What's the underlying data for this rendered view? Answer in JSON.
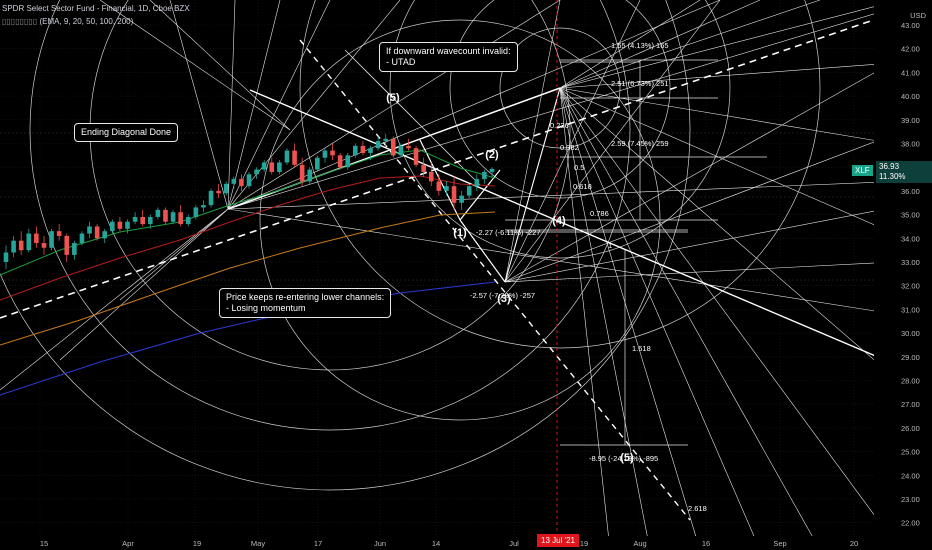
{
  "header": {
    "title": "SPDR Select Sector Fund - Financial, 1D, Cboe BZX",
    "indicator": "EMA, 9, 20, 50, 100, 200",
    "indicator_prefix": "▯▯▯▯▯▯▯▯"
  },
  "price_axis": {
    "currency": "USD",
    "ticks": [
      "43.00",
      "42.00",
      "41.00",
      "40.00",
      "39.00",
      "38.00",
      "37.00",
      "36.00",
      "35.00",
      "34.00",
      "33.00",
      "32.00",
      "31.00",
      "30.00",
      "29.00",
      "28.00",
      "27.00",
      "26.00",
      "25.00",
      "24.00",
      "23.00",
      "22.00"
    ],
    "symbol_badge": "XLF",
    "last_price": "36.93",
    "last_change": "11.30%"
  },
  "time_axis": {
    "labels": [
      "15",
      "Apr",
      "19",
      "May",
      "17",
      "Jun",
      "14",
      "Jul",
      "19",
      "Aug",
      "16",
      "Sep",
      "20"
    ],
    "cursor_label": "13 Jul '21"
  },
  "callouts": {
    "ending_diagonal": "Ending Diagonal Done",
    "wavecount_invalid": "If downward wavecount invalid:\n- UTAD",
    "reentering": "Price keeps re-entering lower channels:\n- Losing momentum"
  },
  "wave_labels": [
    "(5)",
    "(2)",
    "(1)",
    "(4)",
    "(3)",
    "(5)"
  ],
  "fib_labels": [
    "1.65 (4.13%) 165",
    "2.51 (6.73%) 251",
    "2.59 (7.45%) 259",
    "-2.27 (-6.11%) -227",
    "-2.57 (-7.28%) -257",
    "-8.95 (-24.19%) -895",
    "0.236",
    "0.382",
    "0.5",
    "0.618",
    "0.786",
    "1",
    "1.618",
    "2.618"
  ],
  "colors": {
    "background": "#000000",
    "up_candle": "#26a69a",
    "down_candle": "#ef5350",
    "ema_green": "#1b9e3e",
    "ema_red": "#b71c1c",
    "ema_orange": "#c77a1a",
    "ema_blue": "#2b3bd6",
    "fib_lines": "#e6e6e6",
    "cursor": "#e0161c"
  },
  "chart_data": {
    "type": "candlestick",
    "symbol": "XLF",
    "timeframe": "1D",
    "ylim": [
      21.8,
      43.4
    ],
    "x_tick_labels": [
      "15",
      "Apr",
      "19",
      "May",
      "17",
      "Jun",
      "14",
      "Jul",
      "19",
      "Aug",
      "16",
      "Sep",
      "20"
    ],
    "candles": [
      [
        33.0,
        33.7,
        32.7,
        33.4
      ],
      [
        33.4,
        34.1,
        33.2,
        33.9
      ],
      [
        33.9,
        34.3,
        33.3,
        33.5
      ],
      [
        33.5,
        34.4,
        33.4,
        34.2
      ],
      [
        34.2,
        34.5,
        33.6,
        33.8
      ],
      [
        33.8,
        34.1,
        33.3,
        33.6
      ],
      [
        33.6,
        34.4,
        33.5,
        34.3
      ],
      [
        34.3,
        34.6,
        33.9,
        34.1
      ],
      [
        34.1,
        34.2,
        33.0,
        33.3
      ],
      [
        33.3,
        33.9,
        33.1,
        33.8
      ],
      [
        33.8,
        34.3,
        33.7,
        34.2
      ],
      [
        34.2,
        34.7,
        34.0,
        34.5
      ],
      [
        34.5,
        34.6,
        33.9,
        34.0
      ],
      [
        34.0,
        34.4,
        33.8,
        34.3
      ],
      [
        34.3,
        34.8,
        34.2,
        34.7
      ],
      [
        34.7,
        34.9,
        34.3,
        34.4
      ],
      [
        34.4,
        34.8,
        34.2,
        34.7
      ],
      [
        34.7,
        35.1,
        34.6,
        34.9
      ],
      [
        34.9,
        35.2,
        34.5,
        34.6
      ],
      [
        34.6,
        35.0,
        34.4,
        34.9
      ],
      [
        34.9,
        35.3,
        34.8,
        35.2
      ],
      [
        35.2,
        35.3,
        34.6,
        34.7
      ],
      [
        34.7,
        35.2,
        34.6,
        35.1
      ],
      [
        35.1,
        35.4,
        34.5,
        34.6
      ],
      [
        34.6,
        35.0,
        34.5,
        34.9
      ],
      [
        34.9,
        35.4,
        34.8,
        35.3
      ],
      [
        35.3,
        35.6,
        35.1,
        35.4
      ],
      [
        35.4,
        36.1,
        35.3,
        36.0
      ],
      [
        36.0,
        36.3,
        35.7,
        35.9
      ],
      [
        35.9,
        36.4,
        35.8,
        36.3
      ],
      [
        36.3,
        36.6,
        36.1,
        36.5
      ],
      [
        36.5,
        36.7,
        36.0,
        36.2
      ],
      [
        36.2,
        36.8,
        36.1,
        36.7
      ],
      [
        36.7,
        37.0,
        36.5,
        36.9
      ],
      [
        36.9,
        37.3,
        36.8,
        37.2
      ],
      [
        37.2,
        37.4,
        36.7,
        36.8
      ],
      [
        36.8,
        37.3,
        36.7,
        37.2
      ],
      [
        37.2,
        37.8,
        37.1,
        37.7
      ],
      [
        37.7,
        38.0,
        37.0,
        37.1
      ],
      [
        37.1,
        37.4,
        36.2,
        36.4
      ],
      [
        36.4,
        37.0,
        36.3,
        36.9
      ],
      [
        36.9,
        37.5,
        36.8,
        37.4
      ],
      [
        37.4,
        37.8,
        37.2,
        37.7
      ],
      [
        37.7,
        38.0,
        37.3,
        37.5
      ],
      [
        37.5,
        37.6,
        36.9,
        37.0
      ],
      [
        37.0,
        37.6,
        36.9,
        37.5
      ],
      [
        37.5,
        38.0,
        37.4,
        37.9
      ],
      [
        37.9,
        38.1,
        37.5,
        37.6
      ],
      [
        37.6,
        37.9,
        37.3,
        37.8
      ],
      [
        37.8,
        38.3,
        37.7,
        38.1
      ],
      [
        38.1,
        38.4,
        37.9,
        38.2
      ],
      [
        38.2,
        38.3,
        37.4,
        37.5
      ],
      [
        37.5,
        38.0,
        37.4,
        37.9
      ],
      [
        37.9,
        38.2,
        37.7,
        37.8
      ],
      [
        37.8,
        37.9,
        37.0,
        37.1
      ],
      [
        37.1,
        37.4,
        36.6,
        36.8
      ],
      [
        36.8,
        37.2,
        36.2,
        36.4
      ],
      [
        36.4,
        36.7,
        35.8,
        36.0
      ],
      [
        36.0,
        36.4,
        35.8,
        36.2
      ],
      [
        36.2,
        36.6,
        35.2,
        35.5
      ],
      [
        35.5,
        36.0,
        35.2,
        35.8
      ],
      [
        35.8,
        36.3,
        35.7,
        36.2
      ],
      [
        36.2,
        36.7,
        36.0,
        36.5
      ],
      [
        36.5,
        36.9,
        36.3,
        36.8
      ],
      [
        36.8,
        37.0,
        36.6,
        36.93
      ]
    ]
  }
}
